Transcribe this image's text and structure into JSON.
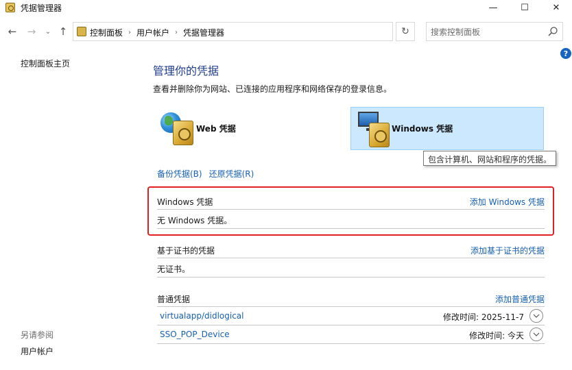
{
  "window": {
    "title": "凭据管理器",
    "min_symbol": "—",
    "max_symbol": "☐",
    "close_symbol": "✕"
  },
  "nav": {
    "back_symbol": "←",
    "forward_symbol": "→",
    "recent_symbol": "⌄",
    "up_symbol": "↑",
    "breadcrumbs": [
      "控制面板",
      "用户帐户",
      "凭据管理器"
    ],
    "crumb_separator": "›",
    "address_dropdown_symbol": "⌄",
    "refresh_symbol": "↻",
    "search_placeholder": "搜索控制面板"
  },
  "help_symbol": "?",
  "left_nav": {
    "home": "控制面板主页",
    "see_also": "另请参阅",
    "user_accounts": "用户帐户"
  },
  "main": {
    "title": "管理你的凭据",
    "description": "查看并删除你为网站、已连接的应用程序和网络保存的登录信息。",
    "web_label": "Web 凭据",
    "windows_label": "Windows 凭据",
    "tooltip": "包含计算机、网站和程序的凭据。",
    "backup_link": "备份凭据(B)",
    "restore_link": "还原凭据(R)"
  },
  "sections": {
    "windows": {
      "title": "Windows 凭据",
      "add": "添加 Windows 凭据",
      "empty": "无 Windows 凭据。"
    },
    "certificate": {
      "title": "基于证书的凭据",
      "add": "添加基于证书的凭据",
      "empty": "无证书。"
    },
    "generic": {
      "title": "普通凭据",
      "add": "添加普通凭据",
      "items": [
        {
          "name": "virtualapp/didlogical",
          "modified": "修改时间:  2025-11-7"
        },
        {
          "name": "SSO_POP_Device",
          "modified": "修改时间:  今天"
        }
      ]
    }
  },
  "colors": {
    "accent_link": "#1660b5",
    "title_blue": "#1e3d8f",
    "selected_card": "#cce8ff",
    "highlight_red": "#e02020"
  }
}
